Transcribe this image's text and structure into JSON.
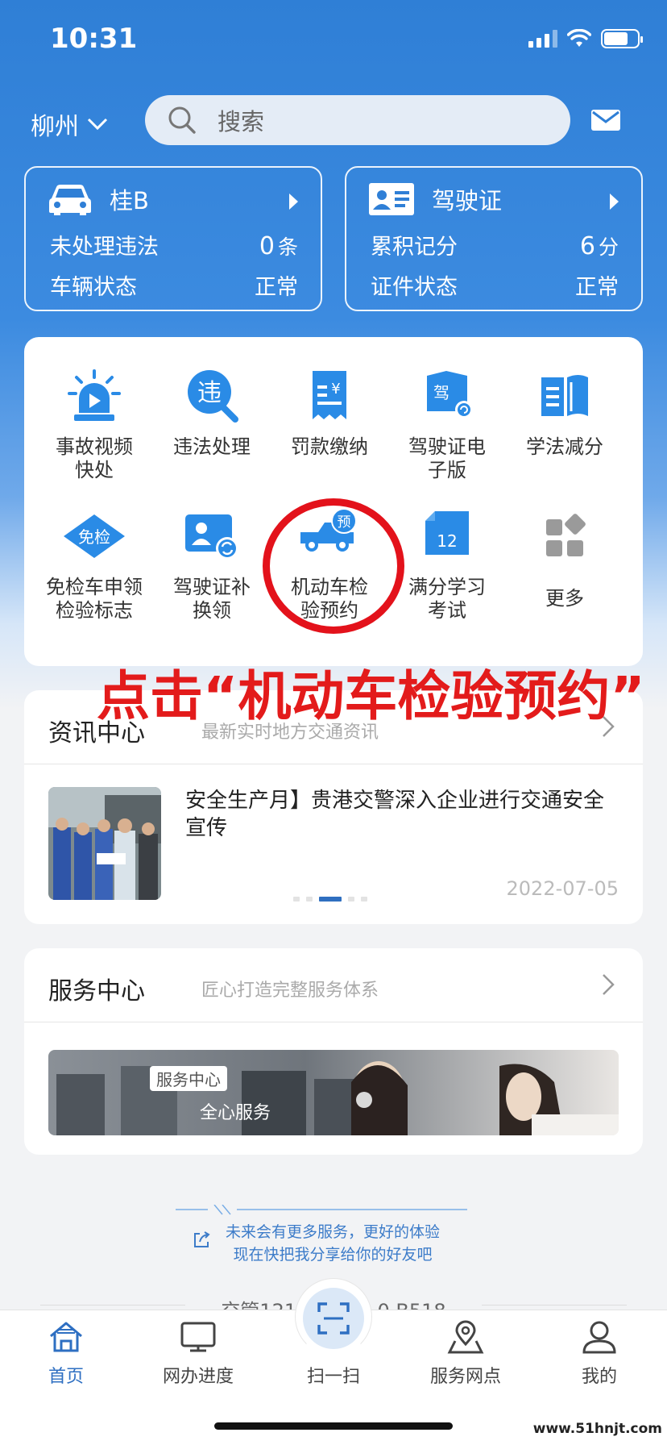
{
  "status_bar": {
    "time": "10:31"
  },
  "header": {
    "city": "柳州",
    "search_placeholder": "搜索"
  },
  "vehicle_card": {
    "plate": "桂B",
    "row1_label": "未处理违法",
    "row1_value": "0",
    "row1_unit": "条",
    "row2_label": "车辆状态",
    "row2_value": "正常"
  },
  "license_card": {
    "title": "驾驶证",
    "row1_label": "累积记分",
    "row1_value": "6",
    "row1_unit": "分",
    "row2_label": "证件状态",
    "row2_value": "正常"
  },
  "services": [
    {
      "label": "事故视频\n快处",
      "icon": "siren-video-icon"
    },
    {
      "label": "违法处理",
      "icon": "violation-search-icon"
    },
    {
      "label": "罚款缴纳",
      "icon": "fine-receipt-icon"
    },
    {
      "label": "驾驶证电\n子版",
      "icon": "e-license-icon"
    },
    {
      "label": "学法减分",
      "icon": "study-book-icon"
    },
    {
      "label": "免检车申领\n检验标志",
      "icon": "exempt-badge-icon"
    },
    {
      "label": "驾驶证补\n换领",
      "icon": "license-replace-icon"
    },
    {
      "label": "机动车检\n验预约",
      "icon": "inspection-appointment-icon"
    },
    {
      "label": "满分学习\n考试",
      "icon": "calendar-12-icon"
    },
    {
      "label": "更多",
      "icon": "more-grid-icon"
    }
  ],
  "icon_text": {
    "violation": "违",
    "exempt": "免检",
    "license_badge": "驾",
    "appointment": "预",
    "calendar": "12",
    "fine": "¥"
  },
  "annotation": {
    "caption": "点击“机动车检验预约”"
  },
  "news": {
    "title": "资讯中心",
    "subtitle": "最新实时地方交通资讯",
    "headline": "安全生产月】贵港交警深入企业进行交通安全宣传",
    "date": "2022-07-05"
  },
  "service_center": {
    "title": "服务中心",
    "subtitle": "匠心打造完整服务体系",
    "banner_tag": "服务中心",
    "banner_slogan": "全心服务"
  },
  "footer": {
    "line1": "未来会有更多服务，更好的体验",
    "line2": "现在快把我分享给你的好友吧",
    "version": "交管12123 V3.0.0 B518"
  },
  "tabbar": {
    "home": "首页",
    "progress": "网办进度",
    "scan": "扫一扫",
    "outlets": "服务网点",
    "mine": "我的"
  },
  "watermark": "www.51hnjt.com",
  "colors": {
    "primary": "#2f7fd6",
    "icon_blue": "#2a8be6",
    "annotation_red": "#e3121b"
  }
}
